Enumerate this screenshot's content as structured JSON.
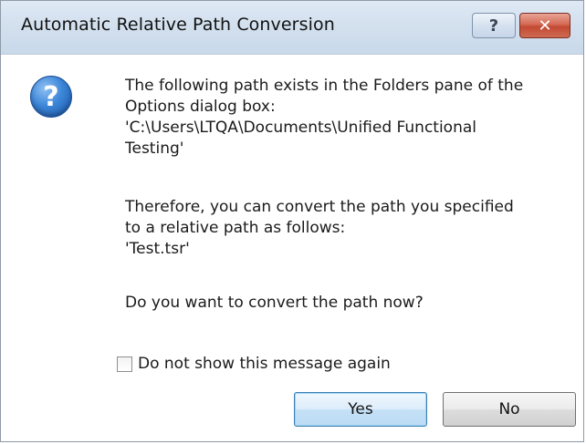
{
  "window": {
    "title": "Automatic Relative Path Conversion",
    "help_glyph": "?",
    "close_glyph": "✕"
  },
  "icon": {
    "name": "question-icon",
    "glyph": "?"
  },
  "message": {
    "paragraph1": "The following path exists in the Folders pane of the\nOptions dialog box:\n'C:\\Users\\LTQA\\Documents\\Unified Functional\nTesting'",
    "paragraph2": "Therefore, you can convert the path you specified\nto a relative path as follows:\n'Test.tsr'",
    "question": "Do you want to convert the path now?"
  },
  "checkbox": {
    "label": "Do not show this message again",
    "checked": false
  },
  "buttons": {
    "yes_label": "Yes",
    "no_label": "No"
  },
  "colors": {
    "close_button": "#c9503a",
    "icon_blue": "#2f74c8",
    "default_button_border": "#3c7fb1"
  }
}
